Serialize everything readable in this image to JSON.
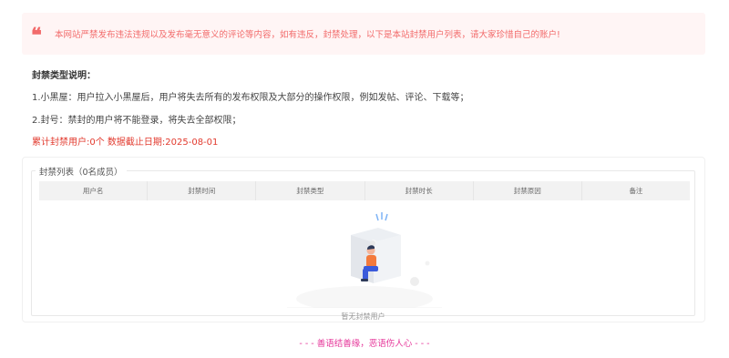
{
  "notice": {
    "text": "本网站严禁发布违法违规以及发布毫无意义的评论等内容，如有违反，封禁处理，以下是本站封禁用户列表，请大家珍惜自己的账户!"
  },
  "ban_info": {
    "title": "封禁类型说明：",
    "item1": "1.小黑屋：用户拉入小黑屋后，用户将失去所有的发布权限及大部分的操作权限，例如发帖、评论、下载等；",
    "item2": "2.封号：禁封的用户将不能登录，将失去全部权限；",
    "stats": "累计封禁用户:0个 数据截止日期:2025-08-01"
  },
  "ban_list": {
    "legend": "封禁列表（0名成员）",
    "columns": [
      "用户名",
      "封禁时间",
      "封禁类型",
      "封禁时长",
      "封禁原因",
      "备注"
    ],
    "empty_text": "暂无封禁用户"
  },
  "footer": {
    "text": "- - - 善语结善缘，恶语伤人心 - - -"
  },
  "colors": {
    "notice": "#f26b6b",
    "stats": "#e23a2e",
    "footer": "#e6399b"
  }
}
